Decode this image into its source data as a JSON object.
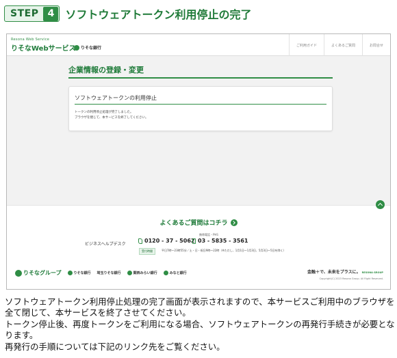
{
  "step": {
    "label": "STEP",
    "number": "4",
    "title": "ソフトウェアトークン利用停止の完了"
  },
  "site": {
    "brand_eyebrow": "Resona Web Service",
    "brand_name": "りそなWebサービス",
    "bank_name": "りそな銀行",
    "nav": [
      "ご利用ガイド",
      "よくあるご質問",
      "お問合せ"
    ]
  },
  "page": {
    "heading": "企業情報の登録・変更",
    "card_title": "ソフトウェアトークンの利用停止",
    "card_lines": [
      "トークンの利用停止処理が完了しました。",
      "ブラウザを閉じて、本サービスを終了してください。"
    ]
  },
  "footer": {
    "faq_link": "よくあるご質問はコチラ",
    "helpdesk_label": "ビジネスヘルプデスク",
    "phone_main": "0120 - 37 - 5062",
    "mobile_label": "携帯電話・PHS",
    "phone_mobile": "03 - 5835 - 3561",
    "hours_label": "受付時間",
    "hours_text": "平日7時〜23時55分／土・日・祝日9時〜22時（※ただし、1月1日〜1月3日、5月3日〜5日を除く）",
    "partners": [
      "りそなグループ",
      "りそな銀行",
      "埼玉りそな銀行",
      "関西みらい銀行",
      "みなと銀行"
    ],
    "slogan": "金融＋で、未来をプラスに。",
    "slogan_group": "RESONA GROUP",
    "copyright": "Copyright(C) 2023 Resona Group. All Right Reserved."
  },
  "description": [
    "ソフトウェアトークン利用停止処理の完了画面が表示されますので、本サービスご利用中のブラウザを全て閉じて、本サービスを終了させてください。",
    "トークン停止後、再度トークンをご利用になる場合、ソフトウェアトークンの再発行手続きが必要となります。",
    "再発行の手順については下記のリンク先をご覧ください。"
  ],
  "colors": {
    "accent": "#2f8d45",
    "accent_dark": "#1d7a38",
    "badge_bg": "#e7f4ea"
  }
}
